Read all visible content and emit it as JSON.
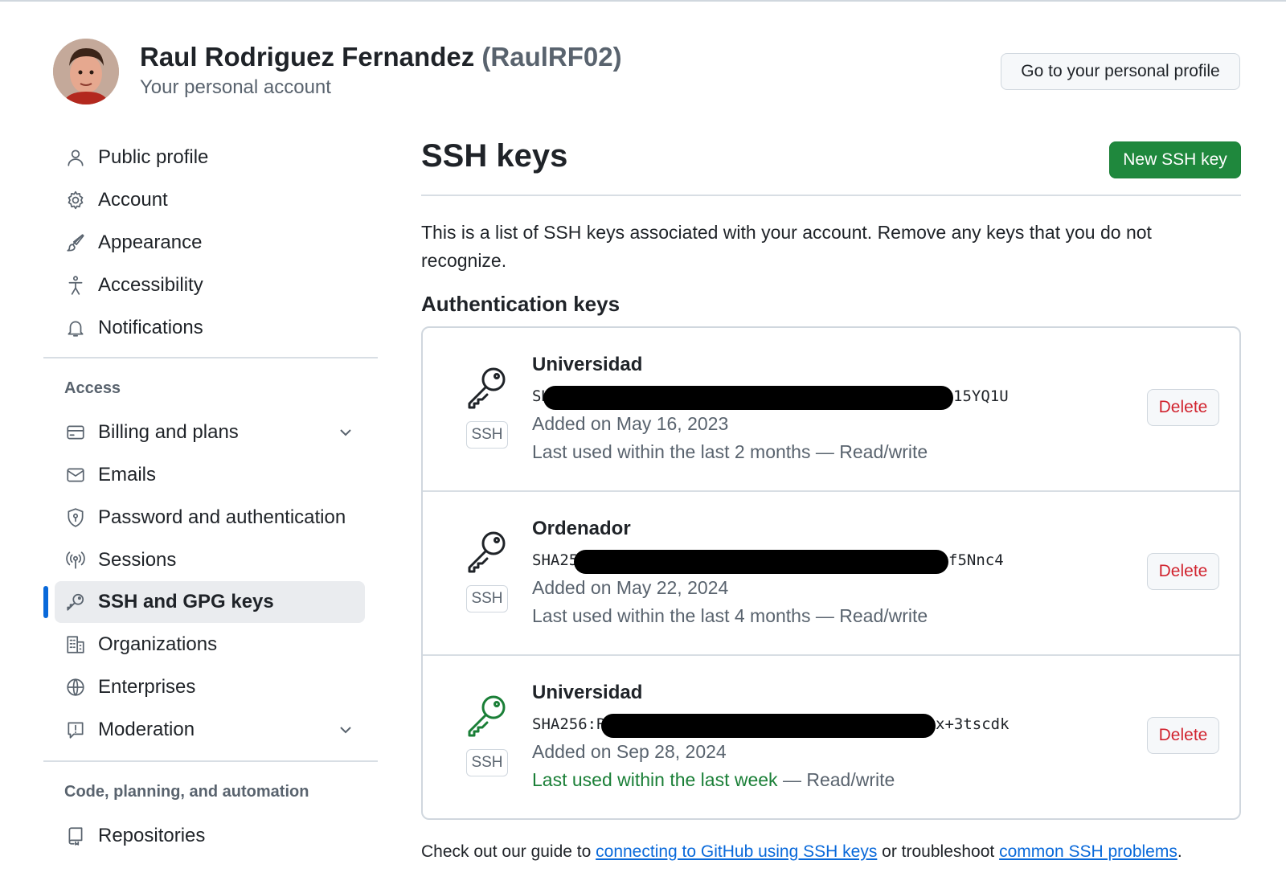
{
  "header": {
    "user_full_name": "Raul Rodriguez Fernandez",
    "user_login": "(RaulRF02)",
    "subtitle": "Your personal account",
    "profile_button": "Go to your personal profile"
  },
  "sidebar": {
    "top_items": [
      {
        "label": "Public profile",
        "icon": "person-icon"
      },
      {
        "label": "Account",
        "icon": "gear-icon"
      },
      {
        "label": "Appearance",
        "icon": "paintbrush-icon"
      },
      {
        "label": "Accessibility",
        "icon": "accessibility-icon"
      },
      {
        "label": "Notifications",
        "icon": "bell-icon"
      }
    ],
    "access_heading": "Access",
    "access_items": [
      {
        "label": "Billing and plans",
        "icon": "credit-card-icon",
        "expandable": true
      },
      {
        "label": "Emails",
        "icon": "mail-icon"
      },
      {
        "label": "Password and authentication",
        "icon": "shield-lock-icon"
      },
      {
        "label": "Sessions",
        "icon": "broadcast-icon"
      },
      {
        "label": "SSH and GPG keys",
        "icon": "key-icon",
        "active": true
      },
      {
        "label": "Organizations",
        "icon": "organization-icon"
      },
      {
        "label": "Enterprises",
        "icon": "globe-icon"
      },
      {
        "label": "Moderation",
        "icon": "report-icon",
        "expandable": true
      }
    ],
    "code_heading": "Code, planning, and automation",
    "code_items": [
      {
        "label": "Repositories",
        "icon": "repo-icon"
      }
    ]
  },
  "main": {
    "title": "SSH keys",
    "new_key_button": "New SSH key",
    "intro": "This is a list of SSH keys associated with your account. Remove any keys that you do not recognize.",
    "auth_heading": "Authentication keys",
    "keys": [
      {
        "title": "Universidad",
        "fingerprint_start": "SH",
        "fingerprint_end": "15YQ1U",
        "badge": "SSH",
        "added": "Added on May 16, 2023",
        "last_used": "Last used within the last 2 months",
        "access": " — Read/write",
        "recent": false,
        "delete_label": "Delete"
      },
      {
        "title": "Ordenador",
        "fingerprint_start": "SHA25",
        "fingerprint_end": "f5Nnc4",
        "badge": "SSH",
        "added": "Added on May 22, 2024",
        "last_used": "Last used within the last 4 months",
        "access": " — Read/write",
        "recent": false,
        "delete_label": "Delete"
      },
      {
        "title": "Universidad",
        "fingerprint_start": "SHA256:R",
        "fingerprint_end": "x+3tscdk",
        "badge": "SSH",
        "added": "Added on Sep 28, 2024",
        "last_used": "Last used within the last week",
        "access": " — Read/write",
        "recent": true,
        "delete_label": "Delete"
      }
    ],
    "footer": {
      "prefix": "Check out our guide to ",
      "link1": "connecting to GitHub using SSH keys",
      "middle": " or troubleshoot ",
      "link2": "common SSH problems",
      "suffix": "."
    }
  },
  "colors": {
    "accent_blue": "#0969da",
    "success_green": "#1f883d",
    "danger_red": "#d1242f",
    "muted_text": "#59636e"
  }
}
